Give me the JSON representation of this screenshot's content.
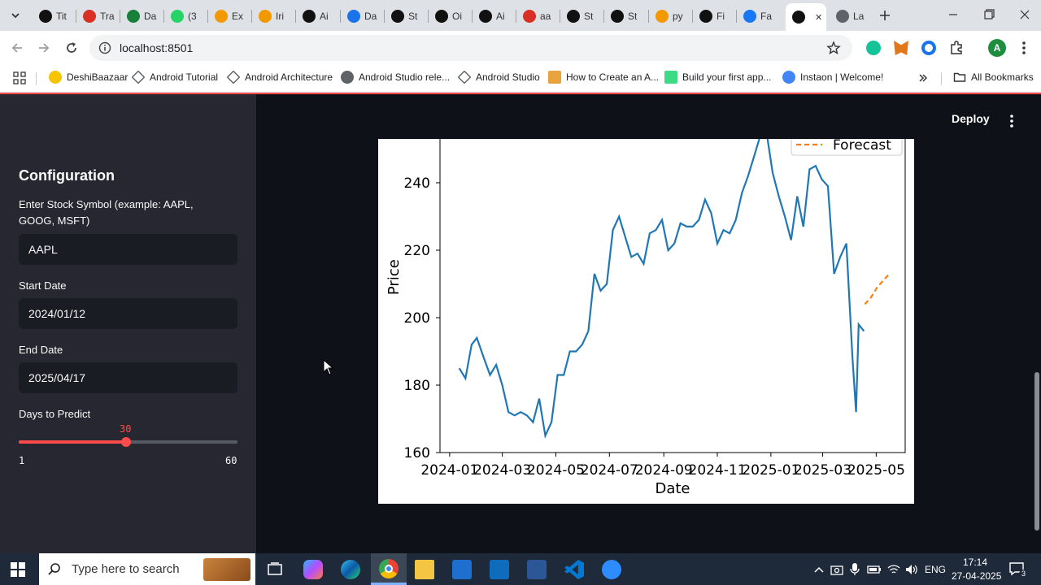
{
  "browser": {
    "tabs": [
      {
        "label": "Tit",
        "color": "#111111"
      },
      {
        "label": "Tra",
        "color": "#d93025"
      },
      {
        "label": "Da",
        "color": "#188038"
      },
      {
        "label": "(3",
        "color": "#25d366"
      },
      {
        "label": "Ex",
        "color": "#f29900"
      },
      {
        "label": "Iri",
        "color": "#f29900"
      },
      {
        "label": "Ai",
        "color": "#111111"
      },
      {
        "label": "Da",
        "color": "#1a73e8"
      },
      {
        "label": "St",
        "color": "#111111"
      },
      {
        "label": "Oi",
        "color": "#111111"
      },
      {
        "label": "Ai",
        "color": "#111111"
      },
      {
        "label": "aa",
        "color": "#d93025"
      },
      {
        "label": "St",
        "color": "#111111"
      },
      {
        "label": "St",
        "color": "#111111"
      },
      {
        "label": "py",
        "color": "#f29900"
      },
      {
        "label": "Fi",
        "color": "#111111"
      },
      {
        "label": "Fa",
        "color": "#1877f2"
      },
      {
        "label": "",
        "color": "#111111"
      },
      {
        "label": "La",
        "color": "#5f6368"
      }
    ],
    "url": "localhost:8501",
    "bookmarks": [
      {
        "label": "DeshiBaazaar"
      },
      {
        "label": "Android Tutorial"
      },
      {
        "label": "Android Architecture"
      },
      {
        "label": "Android Studio rele..."
      },
      {
        "label": "Android Studio"
      },
      {
        "label": "How to Create an A..."
      },
      {
        "label": "Build your first app..."
      },
      {
        "label": "Instaon | Welcome!"
      }
    ],
    "all_bookmarks_label": "All Bookmarks",
    "profile_initial": "A"
  },
  "app": {
    "deploy_label": "Deploy",
    "sidebar": {
      "title": "Configuration",
      "symbol_label": "Enter Stock Symbol (example: AAPL, GOOG, MSFT)",
      "symbol_value": "AAPL",
      "start_label": "Start Date",
      "start_value": "2024/01/12",
      "end_label": "End Date",
      "end_value": "2025/04/17",
      "days_label": "Days to Predict",
      "days_value": "30",
      "days_min": "1",
      "days_max": "60",
      "accent": "#ff4b4b"
    }
  },
  "chart_data": {
    "type": "line",
    "xlabel": "Date",
    "ylabel": "Price",
    "x_ticks": [
      "2024-01",
      "2024-03",
      "2024-05",
      "2024-07",
      "2024-09",
      "2024-11",
      "2025-01",
      "2025-03",
      "2025-05"
    ],
    "y_ticks": [
      160,
      180,
      200,
      220,
      240
    ],
    "ylim": [
      160,
      253
    ],
    "legend_visible": [
      "Forecast"
    ],
    "series": [
      {
        "name": "",
        "color": "#1f77b4",
        "style": "solid",
        "points": [
          [
            "2024-01-12",
            185
          ],
          [
            "2024-01-19",
            182
          ],
          [
            "2024-01-26",
            192
          ],
          [
            "2024-02-01",
            194
          ],
          [
            "2024-02-09",
            188
          ],
          [
            "2024-02-16",
            183
          ],
          [
            "2024-02-23",
            186
          ],
          [
            "2024-03-01",
            180
          ],
          [
            "2024-03-08",
            172
          ],
          [
            "2024-03-15",
            171
          ],
          [
            "2024-03-22",
            172
          ],
          [
            "2024-03-29",
            171
          ],
          [
            "2024-04-05",
            169
          ],
          [
            "2024-04-12",
            176
          ],
          [
            "2024-04-19",
            165
          ],
          [
            "2024-04-26",
            169
          ],
          [
            "2024-05-03",
            183
          ],
          [
            "2024-05-10",
            183
          ],
          [
            "2024-05-17",
            190
          ],
          [
            "2024-05-24",
            190
          ],
          [
            "2024-05-31",
            192
          ],
          [
            "2024-06-07",
            196
          ],
          [
            "2024-06-14",
            213
          ],
          [
            "2024-06-21",
            208
          ],
          [
            "2024-06-28",
            210
          ],
          [
            "2024-07-05",
            226
          ],
          [
            "2024-07-12",
            230
          ],
          [
            "2024-07-19",
            224
          ],
          [
            "2024-07-26",
            218
          ],
          [
            "2024-08-02",
            219
          ],
          [
            "2024-08-09",
            216
          ],
          [
            "2024-08-16",
            225
          ],
          [
            "2024-08-23",
            226
          ],
          [
            "2024-08-30",
            229
          ],
          [
            "2024-09-06",
            220
          ],
          [
            "2024-09-13",
            222
          ],
          [
            "2024-09-20",
            228
          ],
          [
            "2024-09-27",
            227
          ],
          [
            "2024-10-04",
            227
          ],
          [
            "2024-10-11",
            229
          ],
          [
            "2024-10-18",
            235
          ],
          [
            "2024-10-25",
            231
          ],
          [
            "2024-11-01",
            222
          ],
          [
            "2024-11-08",
            226
          ],
          [
            "2024-11-15",
            225
          ],
          [
            "2024-11-22",
            229
          ],
          [
            "2024-11-29",
            237
          ],
          [
            "2024-12-06",
            242
          ],
          [
            "2024-12-13",
            248
          ],
          [
            "2024-12-20",
            254
          ],
          [
            "2024-12-27",
            255
          ],
          [
            "2025-01-03",
            243
          ],
          [
            "2025-01-10",
            236
          ],
          [
            "2025-01-17",
            230
          ],
          [
            "2025-01-24",
            223
          ],
          [
            "2025-01-31",
            236
          ],
          [
            "2025-02-07",
            227
          ],
          [
            "2025-02-14",
            244
          ],
          [
            "2025-02-21",
            245
          ],
          [
            "2025-02-28",
            241
          ],
          [
            "2025-03-07",
            239
          ],
          [
            "2025-03-14",
            213
          ],
          [
            "2025-03-21",
            218
          ],
          [
            "2025-03-28",
            222
          ],
          [
            "2025-04-04",
            188
          ],
          [
            "2025-04-08",
            172
          ],
          [
            "2025-04-11",
            198
          ],
          [
            "2025-04-17",
            196
          ]
        ]
      },
      {
        "name": "Forecast",
        "color": "#ff7f0e",
        "style": "dashed",
        "points": [
          [
            "2025-04-18",
            204
          ],
          [
            "2025-04-25",
            206
          ],
          [
            "2025-05-02",
            209
          ],
          [
            "2025-05-09",
            211
          ],
          [
            "2025-05-16",
            213
          ]
        ]
      }
    ]
  },
  "taskbar": {
    "search_placeholder": "Type here to search",
    "lang": "ENG",
    "time": "17:14",
    "date": "27-04-2025",
    "notification_count": "3"
  }
}
